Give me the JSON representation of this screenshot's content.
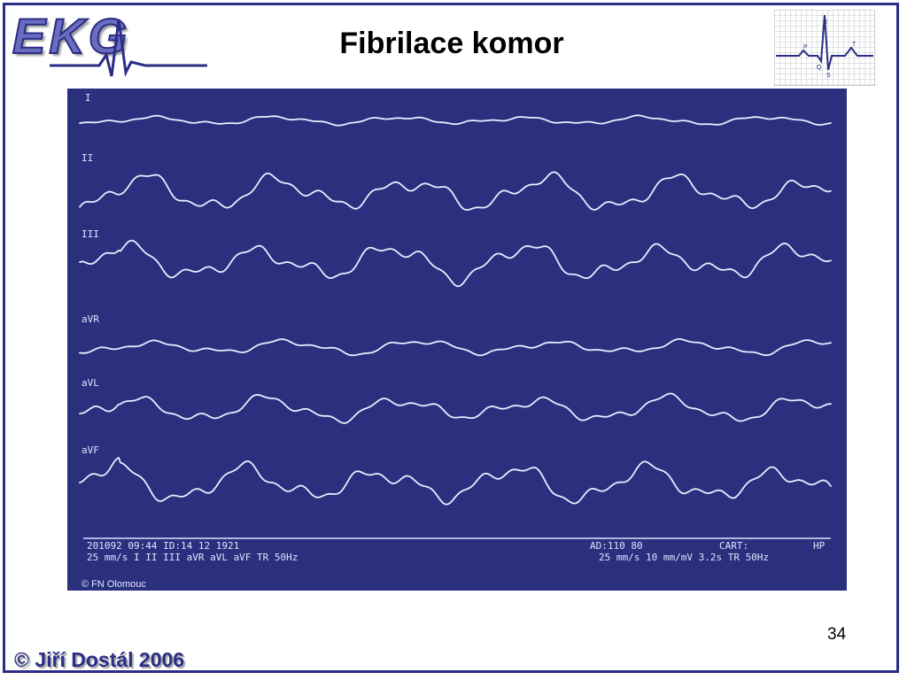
{
  "logo": {
    "text": "EKG"
  },
  "slide": {
    "title": "Fibrilace komor",
    "page_number": "34",
    "copyright": "© Jiří Dostál 2006"
  },
  "ecg_icon": {
    "labels": [
      "R",
      "P",
      "T",
      "Q",
      "S"
    ]
  },
  "ecg": {
    "leads": [
      "I",
      "II",
      "III",
      "aVR",
      "aVL",
      "aVF"
    ],
    "footer_left_line1": "201092 09:44 ID:14 12 1921",
    "footer_left_line2": "25 mm/s I II III aVR aVL aVF TR 50Hz",
    "footer_right_line1a": "AD:110 80",
    "footer_right_line1b": "CART:",
    "footer_right_line1c": "HP",
    "footer_right_line2": "25 mm/s 10 mm/mV 3.2s TR 50Hz",
    "credit": "© FN Olomouc"
  },
  "colors": {
    "frame": "#2b2d86",
    "ecg_background": "#2a2f7e",
    "trace": "#e8ecff",
    "copyright": "#2b2d86"
  }
}
